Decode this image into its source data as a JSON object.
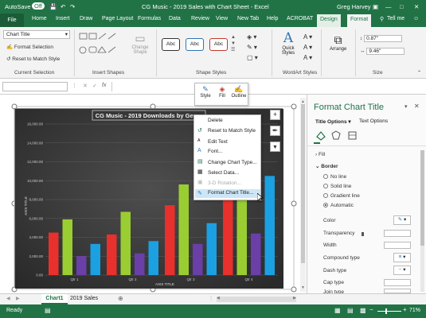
{
  "titlebar": {
    "autosave": "AutoSave",
    "autosave_state": "Off",
    "title": "CG Music - 2019 Sales with Chart Sheet  -  Excel",
    "user": "Greg Harvey",
    "chart_tools": "Chart Tools"
  },
  "tabs": {
    "file": "File",
    "home": "Home",
    "insert": "Insert",
    "draw": "Draw",
    "page_layout": "Page Layout",
    "formulas": "Formulas",
    "data": "Data",
    "review": "Review",
    "view": "View",
    "new_tab": "New Tab",
    "help": "Help",
    "acrobat": "ACROBAT",
    "design": "Design",
    "format": "Format",
    "tell_me": "Tell me"
  },
  "ribbon": {
    "element_select": "Chart Title",
    "format_selection": "Format Selection",
    "reset_style": "Reset to Match Style",
    "current_selection": "Current Selection",
    "change_shape": "Change Shape",
    "insert_shapes": "Insert Shapes",
    "abc": "Abc",
    "shape_styles": "Shape Styles",
    "quick_styles": "Quick Styles",
    "wordart_styles": "WordArt Styles",
    "arrange": "Arrange",
    "height": "0.87\"",
    "width": "9.46\"",
    "size": "Size"
  },
  "formula": {
    "name_box": "",
    "fx": "fx"
  },
  "mini_toolbar": {
    "style": "Style",
    "fill": "Fill",
    "outline": "Outline"
  },
  "context_menu": {
    "delete": "Delete",
    "reset": "Reset to Match Style",
    "edit_text": "Edit Text",
    "font": "Font...",
    "change_type": "Change Chart Type...",
    "select_data": "Select Data...",
    "rotation": "3-D Rotation...",
    "format_title": "Format Chart Title..."
  },
  "pane": {
    "title": "Format Chart Title",
    "title_options": "Title Options",
    "text_options": "Text Options",
    "fill": "Fill",
    "border": "Border",
    "no_line": "No line",
    "solid_line": "Solid line",
    "gradient_line": "Gradient line",
    "automatic": "Automatic",
    "color": "Color",
    "transparency": "Transparency",
    "width": "Width",
    "compound_type": "Compound type",
    "dash_type": "Dash type",
    "cap_type": "Cap type",
    "join_type": "Join type"
  },
  "sheets": {
    "chart1": "Chart1",
    "sales": "2019 Sales"
  },
  "status": {
    "ready": "Ready",
    "zoom": "71%"
  },
  "colors": {
    "excel_green": "#217346",
    "red": "#e8302d",
    "lime": "#9acd32",
    "purple": "#6a3fa8",
    "blue": "#1ba0e2"
  },
  "chart_data": {
    "type": "bar",
    "title": "CG Music - 2019 Downloads by Genre",
    "xlabel": "AXIS TITLE",
    "ylabel": "AXIS TITLE",
    "categories": [
      "Qtr 1",
      "Qtr 2",
      "Qtr 3",
      "Qtr 4"
    ],
    "ylim": [
      0,
      16000
    ],
    "yticks": [
      "16,000.00",
      "14,000.00",
      "12,000.00",
      "10,000.00",
      "8,000.00",
      "6,000.00",
      "4,000.00",
      "2,000.00",
      "0.00"
    ],
    "series": [
      {
        "color": "#e8302d",
        "values": [
          4500,
          4300,
          7400,
          9000
        ]
      },
      {
        "color": "#9acd32",
        "values": [
          5900,
          6700,
          9600,
          9700
        ]
      },
      {
        "color": "#6a3fa8",
        "values": [
          2000,
          2300,
          3300,
          4400
        ]
      },
      {
        "color": "#1ba0e2",
        "values": [
          3300,
          3600,
          5500,
          10500
        ]
      }
    ],
    "grid": true,
    "legend": "none"
  }
}
